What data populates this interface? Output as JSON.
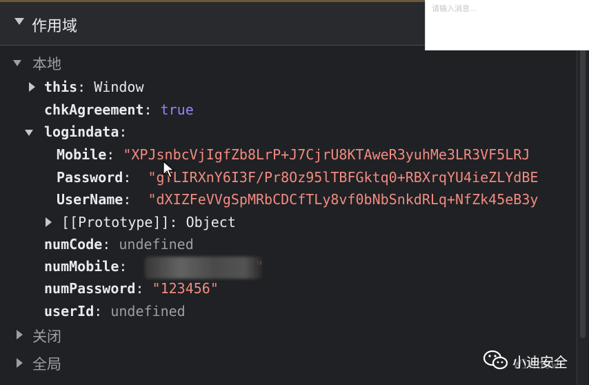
{
  "header": {
    "title": "作用域"
  },
  "sections": {
    "local": "本地",
    "closure": "关闭",
    "global": "全局"
  },
  "local_items": [
    {
      "key": "this",
      "value": "Window"
    },
    {
      "key": "chkAgreement",
      "value": "true"
    },
    {
      "key": "logindata",
      "value": ""
    },
    {
      "key": "Mobile",
      "value": "\"XPJsnbcVjIgfZb8LrP+J7CjrU8KTAweR3yuhMe3LR3VF5LRJ"
    },
    {
      "key": "Password",
      "value": "\"gTLIRXnY6I3F/Pr8Oz95lTBFGktq0+RBXrqYU4ieZLYdBE"
    },
    {
      "key": "UserName",
      "value": "\"dXIZFeVVgSpMRbCDCfTLy8vf0bNbSnkdRLq+NfZk45eB3y"
    },
    {
      "key": "[[Prototype]]",
      "value": "Object"
    },
    {
      "key": "numCode",
      "value": "undefined"
    },
    {
      "key": "numMobile",
      "value": "\""
    },
    {
      "key": "numPassword",
      "value": "\"123456\""
    },
    {
      "key": "userId",
      "value": "undefined"
    }
  ],
  "colon": ":",
  "message_box": {
    "placeholder": "请输入消息..."
  },
  "watermark": {
    "text": "小迪安全",
    "ghost": "Window"
  },
  "colors": {
    "background": "#202124",
    "string": "#f28b82",
    "boolean": "#9980ff",
    "undefined": "#9aa0a6"
  }
}
